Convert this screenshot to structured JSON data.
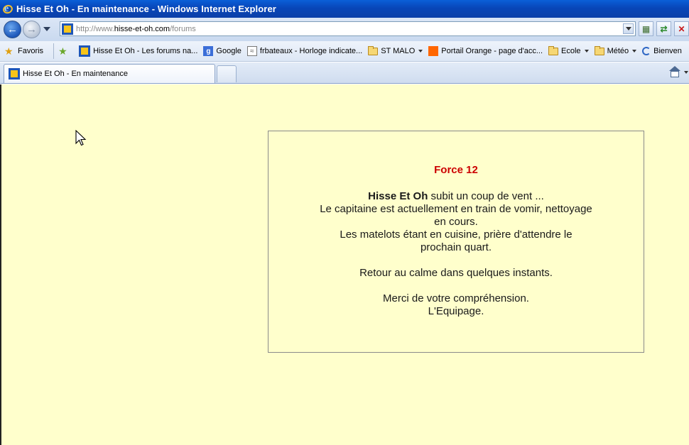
{
  "window": {
    "title": "Hisse Et Oh - En maintenance - Windows Internet Explorer"
  },
  "address": {
    "url_prefix": "http://www.",
    "url_domain": "hisse-et-oh.com",
    "url_path": "/forums"
  },
  "favorites": {
    "label": "Favoris",
    "items": [
      {
        "label": "Hisse Et Oh - Les forums na...",
        "icon": "site-icon"
      },
      {
        "label": "Google",
        "icon": "google-icon"
      },
      {
        "label": "frbateaux - Horloge indicate...",
        "icon": "wave-icon"
      },
      {
        "label": "ST MALO",
        "icon": "folder-icon",
        "dropdown": true
      },
      {
        "label": "Portail Orange - page d'acc...",
        "icon": "orange-icon"
      },
      {
        "label": "Ecole",
        "icon": "folder-icon",
        "dropdown": true
      },
      {
        "label": "Météo",
        "icon": "folder-icon",
        "dropdown": true
      },
      {
        "label": "Bienven",
        "icon": "ie-icon"
      }
    ]
  },
  "tabs": [
    {
      "label": "Hisse Et Oh - En maintenance",
      "active": true
    }
  ],
  "page": {
    "heading": "Force 12",
    "site_name": "Hisse Et Oh",
    "line1_rest": " subit un coup de vent ...",
    "line2": "Le capitaine est actuellement en train de vomir, nettoyage",
    "line3": "en cours.",
    "line4": "Les matelots étant en cuisine, prière d'attendre le",
    "line5": "prochain quart.",
    "line6": "Retour au calme dans quelques instants.",
    "line7": "Merci de votre compréhension.",
    "line8": "L'Equipage."
  },
  "colors": {
    "page_background": "#ffffcc",
    "heading": "#cc0000",
    "titlebar": "#0846b8"
  }
}
